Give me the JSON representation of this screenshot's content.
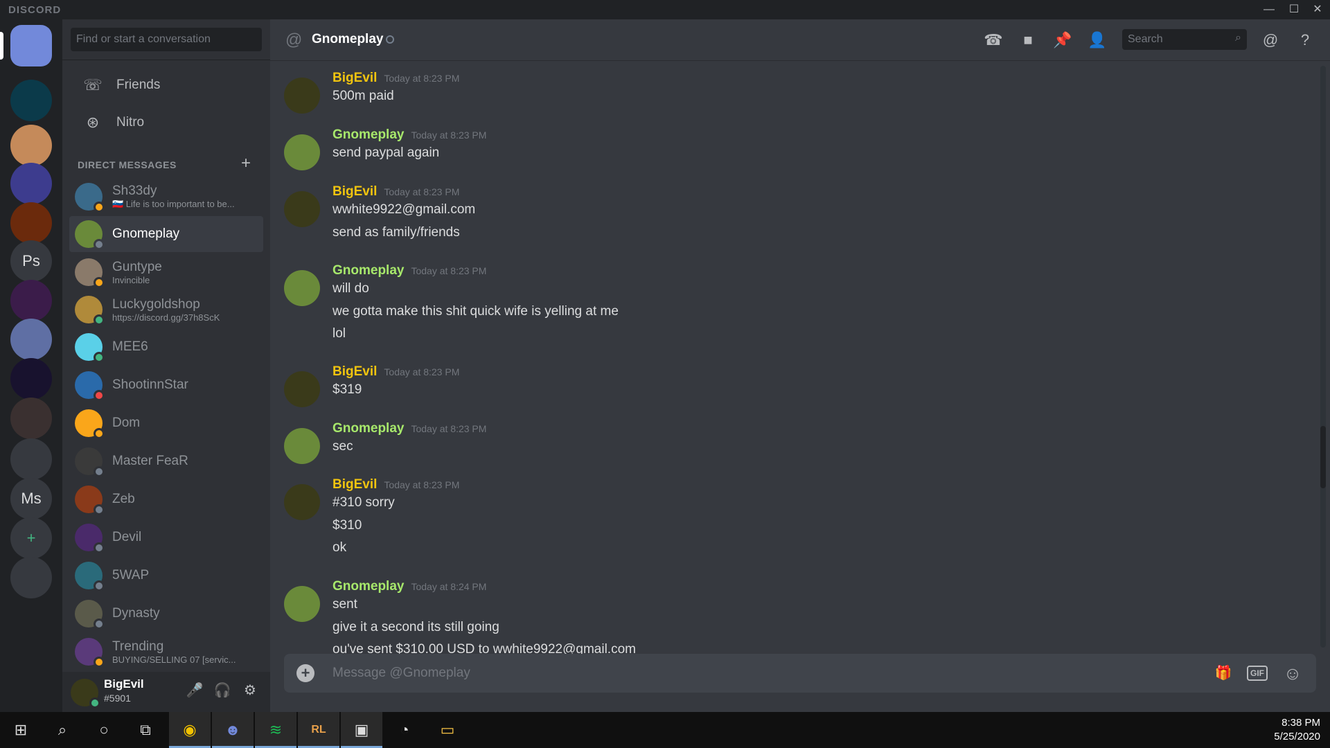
{
  "window": {
    "brand": "DISCORD",
    "minimize": "—",
    "maximize": "☐",
    "close": "✕"
  },
  "servers": [
    {
      "label": "",
      "color": "#7289da"
    },
    {
      "label": "",
      "color": "#0b3a4a"
    },
    {
      "label": "",
      "color": "#c58a5a"
    },
    {
      "label": "",
      "color": "#3d3c8e"
    },
    {
      "label": "",
      "color": "#6b2a0c"
    },
    {
      "label": "Ps",
      "color": "#36393f"
    },
    {
      "label": "",
      "color": "#3b1c4a"
    },
    {
      "label": "",
      "color": "#5f6fa4"
    },
    {
      "label": "",
      "color": "#18122e"
    },
    {
      "label": "",
      "color": "#3a3030"
    },
    {
      "label": "",
      "color": "#36393f"
    },
    {
      "label": "Ms",
      "color": "#36393f"
    },
    {
      "label": "+",
      "color": "#36393f"
    },
    {
      "label": "",
      "color": "#36393f"
    }
  ],
  "dm_panel": {
    "search_placeholder": "Find or start a conversation",
    "nav": [
      {
        "label": "Friends",
        "icon": "friends-icon",
        "glyph": "☏"
      },
      {
        "label": "Nitro",
        "icon": "nitro-icon",
        "glyph": "⊛"
      }
    ],
    "header": "DIRECT MESSAGES",
    "add": "+",
    "dms": [
      {
        "name": "Sh33dy",
        "sub": "🇸🇮 Life is too important to be...",
        "status": "idle",
        "color": "#3a6a8a"
      },
      {
        "name": "Gnomeplay",
        "sub": "",
        "status": "off",
        "color": "#6a8a3a",
        "active": true
      },
      {
        "name": "Guntype",
        "sub": "Invincible",
        "status": "idle",
        "color": "#8a7a6a"
      },
      {
        "name": "Luckygoldshop",
        "sub": "https://discord.gg/37h8ScK",
        "status": "on",
        "color": "#b08a3a"
      },
      {
        "name": "MEE6",
        "sub": "",
        "status": "on",
        "color": "#5ad0e8"
      },
      {
        "name": "ShootinnStar",
        "sub": "",
        "status": "dnd",
        "color": "#2a6aaa"
      },
      {
        "name": "Dom",
        "sub": "",
        "status": "idle",
        "color": "#faa61a"
      },
      {
        "name": "Master FeaR",
        "sub": "",
        "status": "off",
        "color": "#3a3a3a"
      },
      {
        "name": "Zeb",
        "sub": "",
        "status": "off",
        "color": "#8a3a1a"
      },
      {
        "name": "Devil",
        "sub": "",
        "status": "off",
        "color": "#4a2a6a"
      },
      {
        "name": "5WAP",
        "sub": "",
        "status": "off",
        "color": "#2a6a7a"
      },
      {
        "name": "Dynasty",
        "sub": "",
        "status": "off",
        "color": "#5a5a4a"
      },
      {
        "name": "Trending",
        "sub": "BUYING/SELLING 07 [servic...",
        "status": "idle",
        "color": "#5a3a7a"
      }
    ]
  },
  "user": {
    "name": "BigEvil",
    "tag": "#5901",
    "mic": "🎤",
    "headphones": "🎧",
    "settings": "⚙"
  },
  "header": {
    "at": "@",
    "title": "Gnomeplay",
    "search_placeholder": "Search",
    "icons": [
      {
        "name": "call-icon",
        "glyph": "☎"
      },
      {
        "name": "video-icon",
        "glyph": "■"
      },
      {
        "name": "pin-icon",
        "glyph": "📌"
      },
      {
        "name": "add-friend-icon",
        "glyph": "👤"
      },
      {
        "name": "mention-icon",
        "glyph": "@"
      },
      {
        "name": "help-icon",
        "glyph": "?"
      }
    ]
  },
  "messages": [
    {
      "author": "BigEvil",
      "time": "Today at 8:23 PM",
      "lines": [
        "500m paid"
      ]
    },
    {
      "author": "Gnomeplay",
      "time": "Today at 8:23 PM",
      "lines": [
        "send paypal again"
      ]
    },
    {
      "author": "BigEvil",
      "time": "Today at 8:23 PM",
      "lines": [
        "wwhite9922@gmail.com",
        "send as family/friends"
      ]
    },
    {
      "author": "Gnomeplay",
      "time": "Today at 8:23 PM",
      "lines": [
        "will do",
        "we gotta make this shit quick wife is yelling at me",
        "lol"
      ]
    },
    {
      "author": "BigEvil",
      "time": "Today at 8:23 PM",
      "lines": [
        "$319"
      ]
    },
    {
      "author": "Gnomeplay",
      "time": "Today at 8:23 PM",
      "lines": [
        "sec"
      ]
    },
    {
      "author": "BigEvil",
      "time": "Today at 8:23 PM",
      "lines": [
        "#310 sorry",
        "$310",
        "ok"
      ]
    },
    {
      "author": "Gnomeplay",
      "time": "Today at 8:24 PM",
      "lines": [
        "sent",
        "give it a second its still going",
        "ou've sent $310.00 USD to wwhite9922@gmail.com"
      ]
    }
  ],
  "composer": {
    "placeholder": "Message @Gnomeplay",
    "gift": "🎁",
    "gif": "GIF",
    "emoji": "☺"
  },
  "taskbar": {
    "time": "8:38 PM",
    "date": "5/25/2020",
    "apps": [
      {
        "name": "start-icon",
        "glyph": "⊞"
      },
      {
        "name": "search-icon",
        "glyph": "⌕"
      },
      {
        "name": "cortana-icon",
        "glyph": "○"
      },
      {
        "name": "task-view-icon",
        "glyph": "⧉"
      },
      {
        "name": "chrome-icon",
        "glyph": "◉"
      },
      {
        "name": "discord-icon",
        "glyph": "☻"
      },
      {
        "name": "spotify-icon",
        "glyph": "≋"
      },
      {
        "name": "runelite-icon",
        "glyph": "RL"
      },
      {
        "name": "app-icon",
        "glyph": "▣"
      },
      {
        "name": "messenger-icon",
        "glyph": "◔"
      },
      {
        "name": "folder-icon",
        "glyph": "▭"
      }
    ]
  }
}
